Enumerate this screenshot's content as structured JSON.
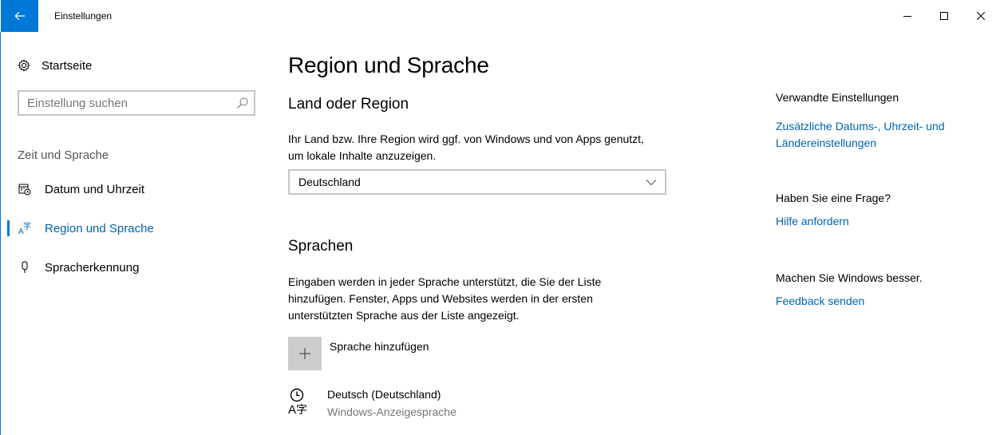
{
  "window": {
    "title": "Einstellungen",
    "accent_color": "#0078d7",
    "back_icon": "arrow-left-icon",
    "controls": [
      "minimize-icon",
      "maximize-icon",
      "close-icon"
    ]
  },
  "sidebar": {
    "home": {
      "label": "Startseite",
      "icon": "gear-icon"
    },
    "search": {
      "placeholder": "Einstellung suchen",
      "value": "",
      "icon": "search-icon"
    },
    "section_title": "Zeit und Sprache",
    "items": [
      {
        "label": "Datum und Uhrzeit",
        "icon": "calendar-clock-icon",
        "selected": false
      },
      {
        "label": "Region und Sprache",
        "icon": "language-icon",
        "selected": true
      },
      {
        "label": "Spracherkennung",
        "icon": "microphone-icon",
        "selected": false
      }
    ]
  },
  "main": {
    "title": "Region und Sprache",
    "region": {
      "heading": "Land oder Region",
      "description": "Ihr Land bzw. Ihre Region wird ggf. von Windows und von Apps genutzt, um lokale Inhalte anzuzeigen.",
      "selected_value": "Deutschland"
    },
    "languages": {
      "heading": "Sprachen",
      "description": "Eingaben werden in jeder Sprache unterstützt, die Sie der Liste hinzufügen. Fenster, Apps und Websites werden in der ersten unterstützten Sprache aus der Liste angezeigt.",
      "add_label": "Sprache hinzufügen",
      "items": [
        {
          "name": "Deutsch (Deutschland)",
          "subtitle": "Windows-Anzeigesprache",
          "icon": "display-language-icon"
        }
      ]
    }
  },
  "related": {
    "heading": "Verwandte Einstellungen",
    "link_additional": "Zusätzliche Datums-, Uhrzeit- und Ländereinstellungen",
    "question_heading": "Haben Sie eine Frage?",
    "link_help": "Hilfe anfordern",
    "feedback_heading": "Machen Sie Windows besser.",
    "link_feedback": "Feedback senden",
    "link_color": "#0063b1"
  }
}
